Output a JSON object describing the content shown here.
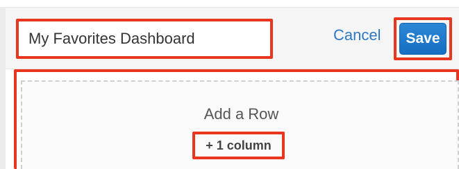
{
  "dashboard": {
    "name_value": "My Favorites Dashboard",
    "cancel_label": "Cancel",
    "save_label": "Save"
  },
  "row": {
    "add_row_label": "Add a Row",
    "add_column_label": "+ 1 column"
  },
  "colors": {
    "highlight": "#e8361f",
    "link": "#2f77c3",
    "primary_button": "#1f7acb"
  }
}
